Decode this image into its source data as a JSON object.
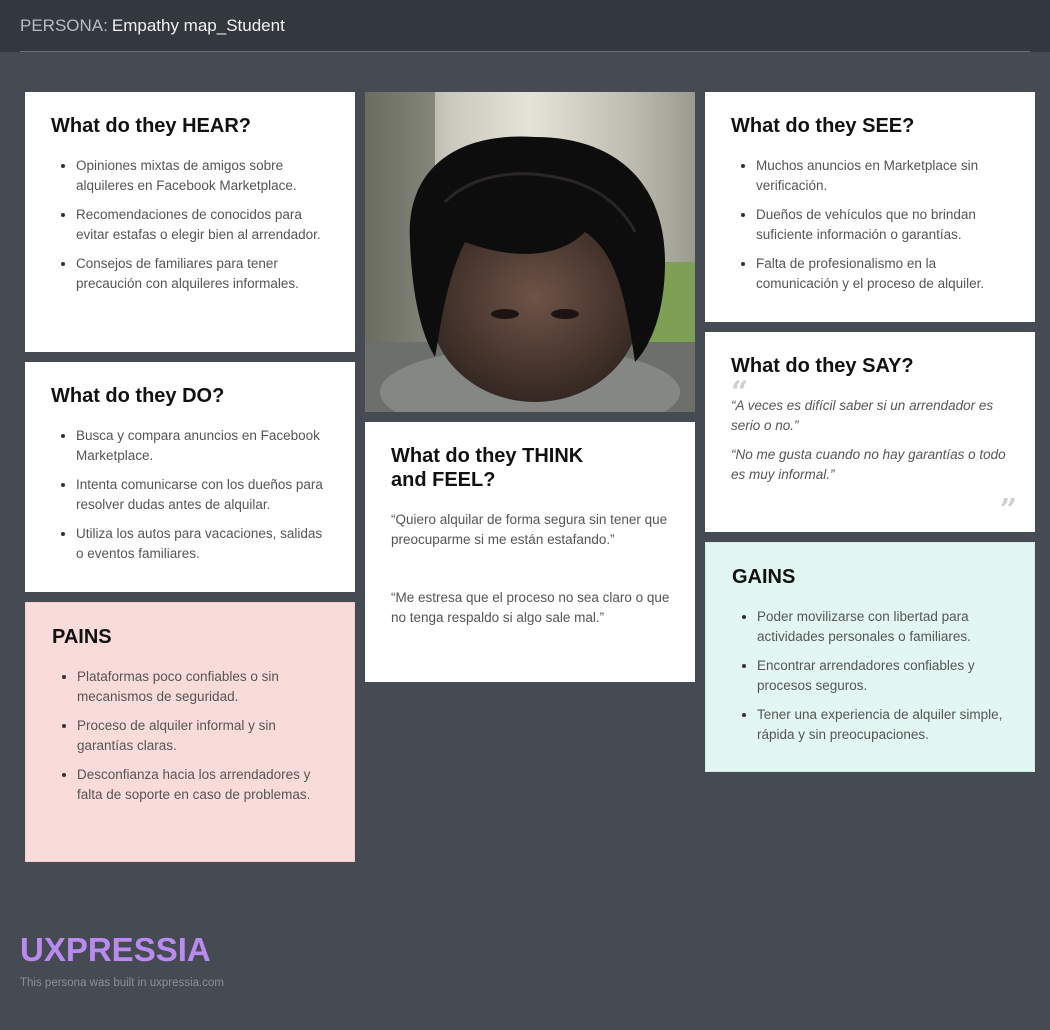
{
  "header": {
    "label": "PERSONA:",
    "title": "Empathy map_Student"
  },
  "hear": {
    "heading": "What do they HEAR?",
    "items": [
      "Opiniones mixtas de amigos sobre alquileres en Facebook Marketplace.",
      "Recomendaciones de conocidos para evitar estafas o elegir bien al arrendador.",
      "Consejos de familiares para tener precaución con alquileres informales."
    ]
  },
  "do": {
    "heading": "What do they DO?",
    "items": [
      "Busca y compara anuncios en Facebook Marketplace.",
      "Intenta comunicarse con los dueños para resolver dudas antes de alquilar.",
      "Utiliza los autos para vacaciones, salidas o eventos familiares."
    ]
  },
  "pains": {
    "heading": "PAINS",
    "items": [
      "Plataformas poco confiables o sin mecanismos de seguridad.",
      "Proceso de alquiler informal y sin garantías claras.",
      "Desconfianza hacia los arrendadores y falta de soporte en caso de problemas."
    ]
  },
  "think_feel": {
    "heading": "What do they THINK and FEEL?",
    "paragraphs": [
      "“Quiero alquilar de forma segura sin tener que preocuparme si me están estafando.”",
      "“Me estresa que el proceso no sea claro o que no tenga respaldo si algo sale mal.”"
    ]
  },
  "see": {
    "heading": "What do they SEE?",
    "items": [
      "Muchos anuncios en Marketplace sin verificación.",
      "Dueños de vehículos que no brindan suficiente información o garantías.",
      "Falta de profesionalismo en la comunicación y el proceso de alquiler."
    ]
  },
  "say": {
    "heading": "What do they SAY?",
    "quotes": [
      "“A veces es difícil saber si un arrendador es serio o no.”",
      "“No me gusta cuando no hay garantías o todo es muy informal.”"
    ]
  },
  "gains": {
    "heading": "GAINS",
    "items": [
      "Poder movilizarse con libertad para actividades personales o familiares.",
      "Encontrar arrendadores confiables y procesos seguros.",
      "Tener una experiencia de alquiler simple, rápida y sin preocupaciones."
    ]
  },
  "footer": {
    "logo": "UXPRESSIA",
    "built_text": "This persona was built in uxpressia.com"
  },
  "colors": {
    "background": "#454a53",
    "header_bg": "#33373e",
    "pains_bg": "#f9dcd9",
    "gains_bg": "#e3f7f2",
    "logo": "#b98bf0"
  }
}
